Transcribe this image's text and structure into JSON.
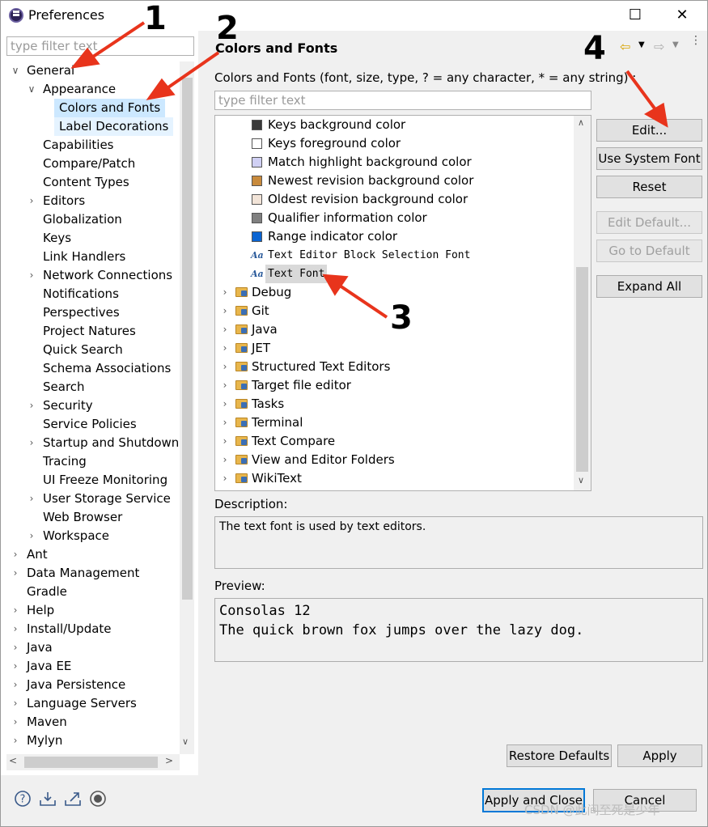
{
  "window": {
    "title": "Preferences",
    "minimize": "—",
    "maximize": "☐",
    "close": "✕"
  },
  "left": {
    "filter_placeholder": "type filter text",
    "tree": [
      {
        "label": "General",
        "level": 0,
        "expanded": true
      },
      {
        "label": "Appearance",
        "level": 1,
        "expanded": true
      },
      {
        "label": "Colors and Fonts",
        "level": 2,
        "selected": true
      },
      {
        "label": "Label Decorations",
        "level": 2,
        "highlighted": true
      },
      {
        "label": "Capabilities",
        "level": 1
      },
      {
        "label": "Compare/Patch",
        "level": 1
      },
      {
        "label": "Content Types",
        "level": 1
      },
      {
        "label": "Editors",
        "level": 1,
        "collapsed": true
      },
      {
        "label": "Globalization",
        "level": 1
      },
      {
        "label": "Keys",
        "level": 1
      },
      {
        "label": "Link Handlers",
        "level": 1
      },
      {
        "label": "Network Connections",
        "level": 1,
        "collapsed": true
      },
      {
        "label": "Notifications",
        "level": 1
      },
      {
        "label": "Perspectives",
        "level": 1
      },
      {
        "label": "Project Natures",
        "level": 1
      },
      {
        "label": "Quick Search",
        "level": 1
      },
      {
        "label": "Schema Associations",
        "level": 1
      },
      {
        "label": "Search",
        "level": 1
      },
      {
        "label": "Security",
        "level": 1,
        "collapsed": true
      },
      {
        "label": "Service Policies",
        "level": 1
      },
      {
        "label": "Startup and Shutdown",
        "level": 1,
        "collapsed": true
      },
      {
        "label": "Tracing",
        "level": 1
      },
      {
        "label": "UI Freeze Monitoring",
        "level": 1
      },
      {
        "label": "User Storage Service",
        "level": 1,
        "collapsed": true
      },
      {
        "label": "Web Browser",
        "level": 1
      },
      {
        "label": "Workspace",
        "level": 1,
        "collapsed": true
      },
      {
        "label": "Ant",
        "level": 0,
        "collapsed": true
      },
      {
        "label": "Data Management",
        "level": 0,
        "collapsed": true
      },
      {
        "label": "Gradle",
        "level": 0
      },
      {
        "label": "Help",
        "level": 0,
        "collapsed": true
      },
      {
        "label": "Install/Update",
        "level": 0,
        "collapsed": true
      },
      {
        "label": "Java",
        "level": 0,
        "collapsed": true
      },
      {
        "label": "Java EE",
        "level": 0,
        "collapsed": true
      },
      {
        "label": "Java Persistence",
        "level": 0,
        "collapsed": true
      },
      {
        "label": "Language Servers",
        "level": 0,
        "collapsed": true
      },
      {
        "label": "Maven",
        "level": 0,
        "collapsed": true
      },
      {
        "label": "Mylyn",
        "level": 0,
        "collapsed": true
      }
    ]
  },
  "main": {
    "title": "Colors and Fonts",
    "subtitle": "Colors and Fonts (font, size, type, ? = any character, * = any string) :",
    "filter_placeholder": "type filter text",
    "items": [
      {
        "label": "Keys background color",
        "kind": "color",
        "color": "#3a3a3a"
      },
      {
        "label": "Keys foreground color",
        "kind": "color",
        "color": "#ffffff"
      },
      {
        "label": "Match highlight background color",
        "kind": "color",
        "color": "#d0d0f4"
      },
      {
        "label": "Newest revision background color",
        "kind": "color",
        "color": "#c88a3c"
      },
      {
        "label": "Oldest revision background color",
        "kind": "color",
        "color": "#f2e4d8"
      },
      {
        "label": "Qualifier information color",
        "kind": "color",
        "color": "#808080"
      },
      {
        "label": "Range indicator color",
        "kind": "color",
        "color": "#0a64d2"
      },
      {
        "label": "Text Editor Block Selection Font",
        "kind": "font"
      },
      {
        "label": "Text Font",
        "kind": "font",
        "selected": true
      },
      {
        "label": "Debug",
        "kind": "folder"
      },
      {
        "label": "Git",
        "kind": "folder"
      },
      {
        "label": "Java",
        "kind": "folder"
      },
      {
        "label": "JET",
        "kind": "folder"
      },
      {
        "label": "Structured Text Editors",
        "kind": "folder"
      },
      {
        "label": "Target file editor",
        "kind": "folder"
      },
      {
        "label": "Tasks",
        "kind": "folder"
      },
      {
        "label": "Terminal",
        "kind": "folder"
      },
      {
        "label": "Text Compare",
        "kind": "folder"
      },
      {
        "label": "View and Editor Folders",
        "kind": "folder"
      },
      {
        "label": "WikiText",
        "kind": "folder"
      }
    ],
    "buttons": {
      "edit": "Edit...",
      "use_system_font": "Use System Font",
      "reset": "Reset",
      "edit_default": "Edit Default...",
      "go_to_default": "Go to Default",
      "expand_all": "Expand All"
    },
    "description_label": "Description:",
    "description_text": "The text font is used by text editors.",
    "preview_label": "Preview:",
    "preview_line1": "Consolas 12",
    "preview_line2": "The quick brown fox jumps over the lazy dog.",
    "restore_defaults": "Restore Defaults",
    "apply": "Apply"
  },
  "footer": {
    "apply_and_close": "Apply and Close",
    "cancel": "Cancel",
    "icons": [
      "help-icon",
      "import-icon",
      "export-icon",
      "record-icon"
    ]
  },
  "annotations": [
    "1",
    "2",
    "3",
    "4"
  ],
  "watermark": "CSDN @此间至死是少年",
  "colors": {
    "selection": "#cce8ff",
    "arrow": "#e8341c",
    "focus": "#0078d7"
  }
}
